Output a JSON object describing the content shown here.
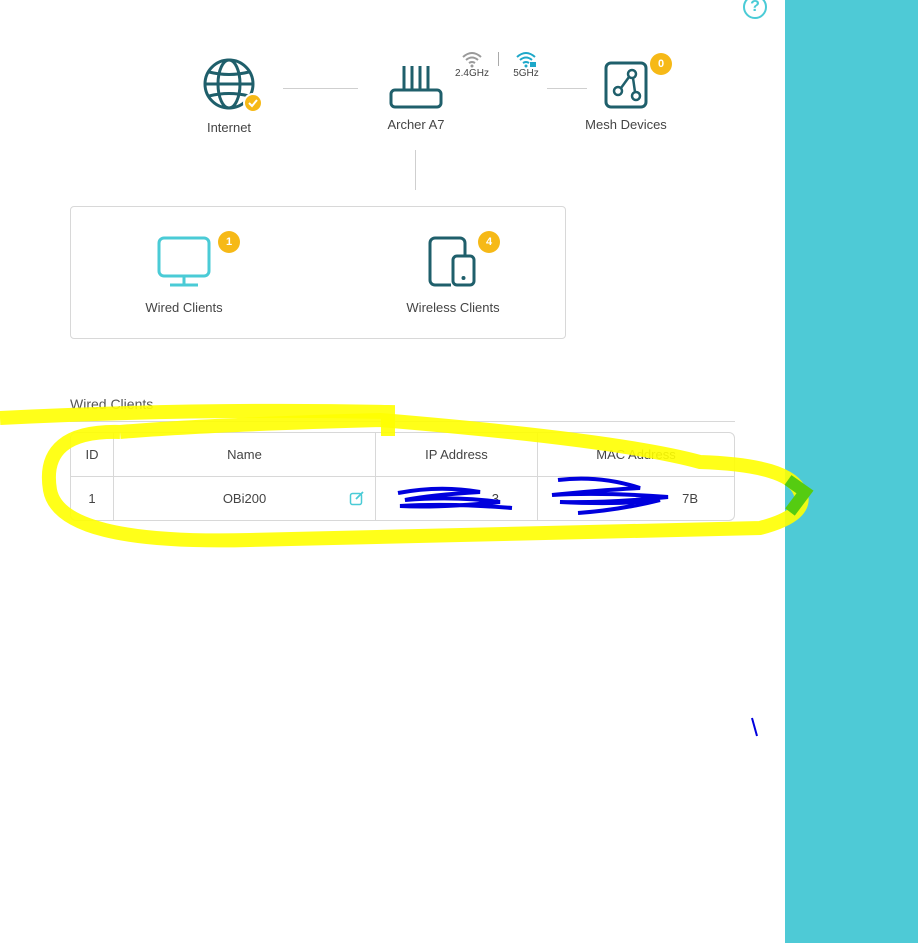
{
  "header": {
    "help_label": "?"
  },
  "topology": {
    "internet": {
      "label": "Internet"
    },
    "router": {
      "label": "Archer A7"
    },
    "bands": [
      {
        "label": "2.4GHz"
      },
      {
        "label": "5GHz"
      }
    ],
    "mesh": {
      "label": "Mesh Devices",
      "count": "0"
    }
  },
  "clients": {
    "wired": {
      "label": "Wired Clients",
      "count": "1"
    },
    "wireless": {
      "label": "Wireless Clients",
      "count": "4"
    }
  },
  "table": {
    "title": "Wired Clients",
    "columns": [
      "ID",
      "Name",
      "IP Address",
      "MAC Address"
    ],
    "rows": [
      {
        "id": "1",
        "name": "OBi200",
        "ip": "3",
        "mac": "7B"
      }
    ]
  },
  "colors": {
    "accent": "#4acbd6",
    "dark_icon": "#1f5f6b",
    "badge": "#f6b917",
    "panel": "#4ecad6",
    "highlight": "#ffff00",
    "scribble": "#0000dd"
  }
}
